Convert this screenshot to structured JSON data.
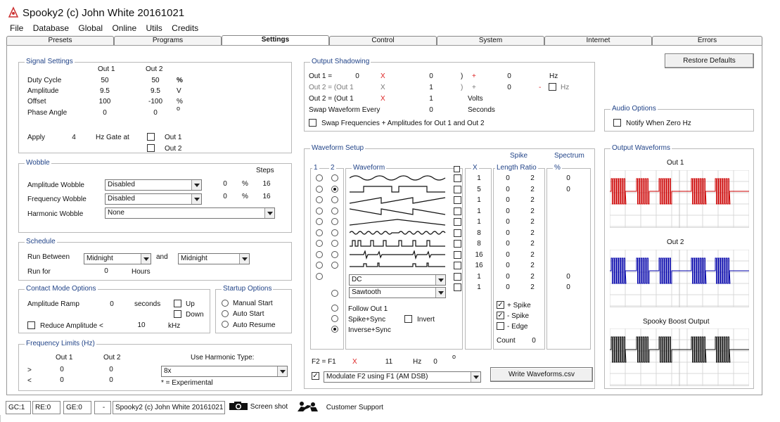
{
  "app": {
    "title": "Spooky2 (c) John White 20161021"
  },
  "menu": [
    "File",
    "Database",
    "Global",
    "Online",
    "Utils",
    "Credits"
  ],
  "tabs": [
    "Presets",
    "Programs",
    "Settings",
    "Control",
    "System",
    "Internet",
    "Errors"
  ],
  "restore_defaults": "Restore Defaults",
  "signal": {
    "title": "Signal Settings",
    "out1": "Out 1",
    "out2": "Out 2",
    "rows": [
      {
        "label": "Duty Cycle",
        "v1": "50",
        "v2": "50",
        "unit": "%"
      },
      {
        "label": "Amplitude",
        "v1": "9.5",
        "v2": "9.5",
        "unit": "V"
      },
      {
        "label": "Offset",
        "v1": "100",
        "v2": "-100",
        "unit": "%"
      },
      {
        "label": "Phase Angle",
        "v1": "0",
        "v2": "0",
        "unit": "o"
      }
    ],
    "apply": "Apply",
    "apply_val": "4",
    "gate": "Hz Gate at",
    "gate_o1": "Out 1",
    "gate_o2": "Out 2"
  },
  "wobble": {
    "title": "Wobble",
    "steps": "Steps",
    "amp_label": "Amplitude Wobble",
    "amp_sel": "Disabled",
    "amp_pct": "0",
    "amp_steps": "16",
    "freq_label": "Frequency Wobble",
    "freq_sel": "Disabled",
    "freq_pct": "0",
    "freq_steps": "16",
    "harm_label": "Harmonic Wobble",
    "harm_sel": "None",
    "pct": "%"
  },
  "schedule": {
    "title": "Schedule",
    "run_between": "Run Between",
    "from": "Midnight",
    "and": "and",
    "to": "Midnight",
    "run_for": "Run for",
    "run_for_val": "0",
    "hours": "Hours"
  },
  "contact": {
    "title": "Contact Mode Options",
    "ramp": "Amplitude Ramp",
    "ramp_val": "0",
    "seconds": "seconds",
    "up": "Up",
    "down": "Down",
    "reduce": "Reduce Amplitude <",
    "reduce_val": "10",
    "khz": "kHz"
  },
  "startup": {
    "title": "Startup Options",
    "options": [
      "Manual Start",
      "Auto Start",
      "Auto Resume"
    ]
  },
  "freqlim": {
    "title": "Frequency Limits (Hz)",
    "out1": "Out 1",
    "out2": "Out 2",
    "gt": ">",
    "lt": "<",
    "gt1": "0",
    "gt2": "0",
    "lt1": "0",
    "lt2": "0",
    "harm_type": "Use Harmonic Type:",
    "harm_sel": "8x",
    "experimental": "* = Experimental"
  },
  "shadow": {
    "title": "Output Shadowing",
    "r1": {
      "label": "Out 1 =",
      "a": "0",
      "x": "X",
      "b": "0",
      "paren": ")",
      "plus": "+",
      "c": "0",
      "unit": "Hz"
    },
    "r2": {
      "label": "Out 2 = (Out 1",
      "x": "X",
      "b": "1",
      "paren": ")",
      "plus": "+",
      "c": "0",
      "minus": "-",
      "unit": "Hz"
    },
    "r3": {
      "label": "Out 2 = (Out 1",
      "x": "X",
      "b": "1",
      "unit": "Volts"
    },
    "swap_label": "Swap Waveform Every",
    "swap_val": "0",
    "swap_unit": "Seconds",
    "swap_freq": "Swap Frequencies + Amplitudes for Out 1 and Out 2"
  },
  "audio": {
    "title": "Audio Options",
    "notify": "Notify When Zero Hz"
  },
  "waveform": {
    "title": "Waveform Setup",
    "col1": "1",
    "col2": "2",
    "col_wave": "Waveform",
    "col_x": "X",
    "spike": "Spike",
    "length": "Length",
    "ratio": "Ratio",
    "spectrum": "Spectrum",
    "pct": "%",
    "rows": [
      {
        "x": "1",
        "len": "0",
        "ratio": "2",
        "spec": "0"
      },
      {
        "x": "5",
        "len": "0",
        "ratio": "2",
        "spec": "0"
      },
      {
        "x": "1",
        "len": "0",
        "ratio": "2",
        "spec": ""
      },
      {
        "x": "1",
        "len": "0",
        "ratio": "2",
        "spec": ""
      },
      {
        "x": "1",
        "len": "0",
        "ratio": "2",
        "spec": ""
      },
      {
        "x": "8",
        "len": "0",
        "ratio": "2",
        "spec": ""
      },
      {
        "x": "8",
        "len": "0",
        "ratio": "2",
        "spec": ""
      },
      {
        "x": "16",
        "len": "0",
        "ratio": "2",
        "spec": ""
      },
      {
        "x": "16",
        "len": "0",
        "ratio": "2",
        "spec": ""
      },
      {
        "x": "1",
        "len": "0",
        "ratio": "2",
        "spec": "0"
      },
      {
        "x": "1",
        "len": "0",
        "ratio": "2",
        "spec": "0"
      }
    ],
    "sel_dc": "DC",
    "sel_saw": "Sawtooth",
    "follow": "Follow Out 1",
    "spike_sync": "Spike+Sync",
    "invert": "Invert",
    "inverse_sync": "Inverse+Sync",
    "plus_spike": "+ Spike",
    "minus_spike": "- Spike",
    "edge": "- Edge",
    "count": "Count",
    "count_val": "0",
    "f2": "F2 = F1",
    "f2x": "X",
    "f2val": "11",
    "hz": "Hz",
    "f2deg": "0",
    "deg": "o",
    "modulate": "Modulate F2 using F1 (AM DSB)",
    "write": "Write Waveforms.csv"
  },
  "outputs": {
    "title": "Output Waveforms",
    "out1": "Out 1",
    "out2": "Out 2",
    "boost": "Spooky Boost Output"
  },
  "status": {
    "gc": "GC:1",
    "re": "RE:0",
    "ge": "GE:0",
    "dash": "-",
    "app": "Spooky2 (c) John White 20161021",
    "screenshot": "Screen shot",
    "support": "Customer Support"
  },
  "colors": {
    "out1": "#cc0000",
    "out2": "#0000aa",
    "boost": "#111111",
    "group_title": "#224488"
  }
}
